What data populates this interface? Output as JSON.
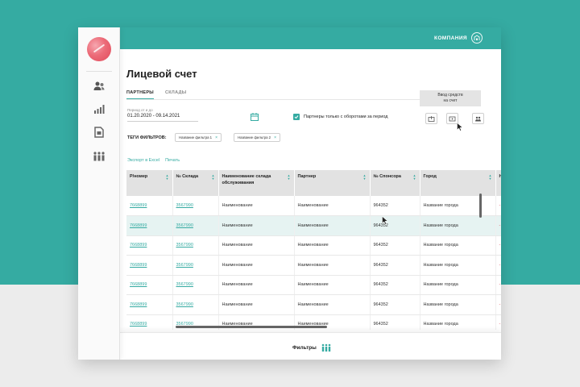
{
  "header": {
    "company_label": "КОМПАНИЯ"
  },
  "page": {
    "title": "Лицевой счет"
  },
  "tabs": [
    {
      "label": "ПАРТНЕРЫ",
      "active": true
    },
    {
      "label": "СКЛАДЫ",
      "active": false
    }
  ],
  "tooltip": {
    "line1": "Ввод средств",
    "line2": "на счет"
  },
  "period": {
    "label": "Период от и до",
    "value": "01.20.2020 - 09.14.2021"
  },
  "filter_checkbox": {
    "label": "Партнеры только с оборотами за период",
    "checked": true
  },
  "tags": {
    "label": "ТЕГИ ФИЛЬТРОВ:",
    "items": [
      "Название фильтра 1",
      "Название фильтра 2"
    ]
  },
  "links": {
    "export": "Экспорт в Excel",
    "print": "Печать"
  },
  "table": {
    "columns": [
      "Р/номер",
      "№ Склада",
      "Наименование склада обслуживания",
      "Партнер",
      "№ Спонсора",
      "Город",
      "Н"
    ],
    "rows": [
      [
        "7668899",
        "3567990",
        "Наименование",
        "Наименование",
        "964352",
        "Название города",
        "-"
      ],
      [
        "7668899",
        "3567990",
        "Наименование",
        "Наименование",
        "964352",
        "Название города",
        "-"
      ],
      [
        "7668899",
        "3567990",
        "Наименование",
        "Наименование",
        "964352",
        "Название города",
        "-"
      ],
      [
        "7668899",
        "3567990",
        "Наименование",
        "Наименование",
        "964352",
        "Название города",
        "-"
      ],
      [
        "7668899",
        "3567990",
        "Наименование",
        "Наименование",
        "964352",
        "Название города",
        "-"
      ],
      [
        "7668899",
        "3567990",
        "Наименование",
        "Наименование",
        "964352",
        "Название города",
        "-"
      ],
      [
        "7668899",
        "3567990",
        "Наименование",
        "Наименование",
        "964352",
        "Название города",
        "-"
      ]
    ]
  },
  "footer": {
    "filters_label": "Фильтры"
  },
  "icons": {
    "sidebar": [
      "users-icon",
      "chart-icon",
      "document-icon",
      "team-icon"
    ],
    "actions": [
      "deposit-icon",
      "video-icon",
      "partners-icon"
    ]
  },
  "colors": {
    "accent": "#35aba2",
    "brand_avatar": "#e14b5b",
    "link_red": "#e14b5b"
  }
}
